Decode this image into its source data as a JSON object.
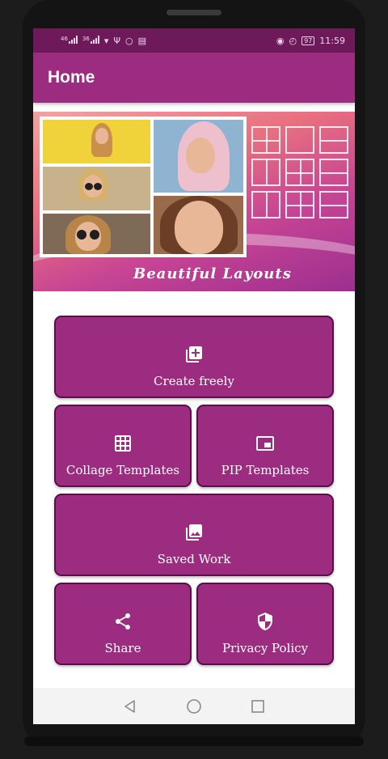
{
  "status_bar": {
    "time": "11:59",
    "battery": "97",
    "signal_tag_1": "46",
    "signal_tag_2": "36"
  },
  "app_bar": {
    "title": "Home"
  },
  "banner": {
    "caption": "Beautiful Layouts"
  },
  "buttons": {
    "create": {
      "label": "Create freely",
      "icon": "add-photo-icon"
    },
    "collage": {
      "label": "Collage Templates",
      "icon": "grid-icon"
    },
    "pip": {
      "label": "PIP Templates",
      "icon": "picture-in-picture-icon"
    },
    "saved": {
      "label": "Saved Work",
      "icon": "photo-library-icon"
    },
    "share": {
      "label": "Share",
      "icon": "share-icon"
    },
    "privacy": {
      "label": "Privacy Policy",
      "icon": "shield-icon"
    }
  },
  "nav": {
    "back": "back-icon",
    "home": "home-icon",
    "recents": "recents-icon"
  },
  "colors": {
    "status_bar": "#6e1a5a",
    "app_bar": "#9b2c80",
    "button": "#9b2c80",
    "button_border": "#5c0e48"
  }
}
